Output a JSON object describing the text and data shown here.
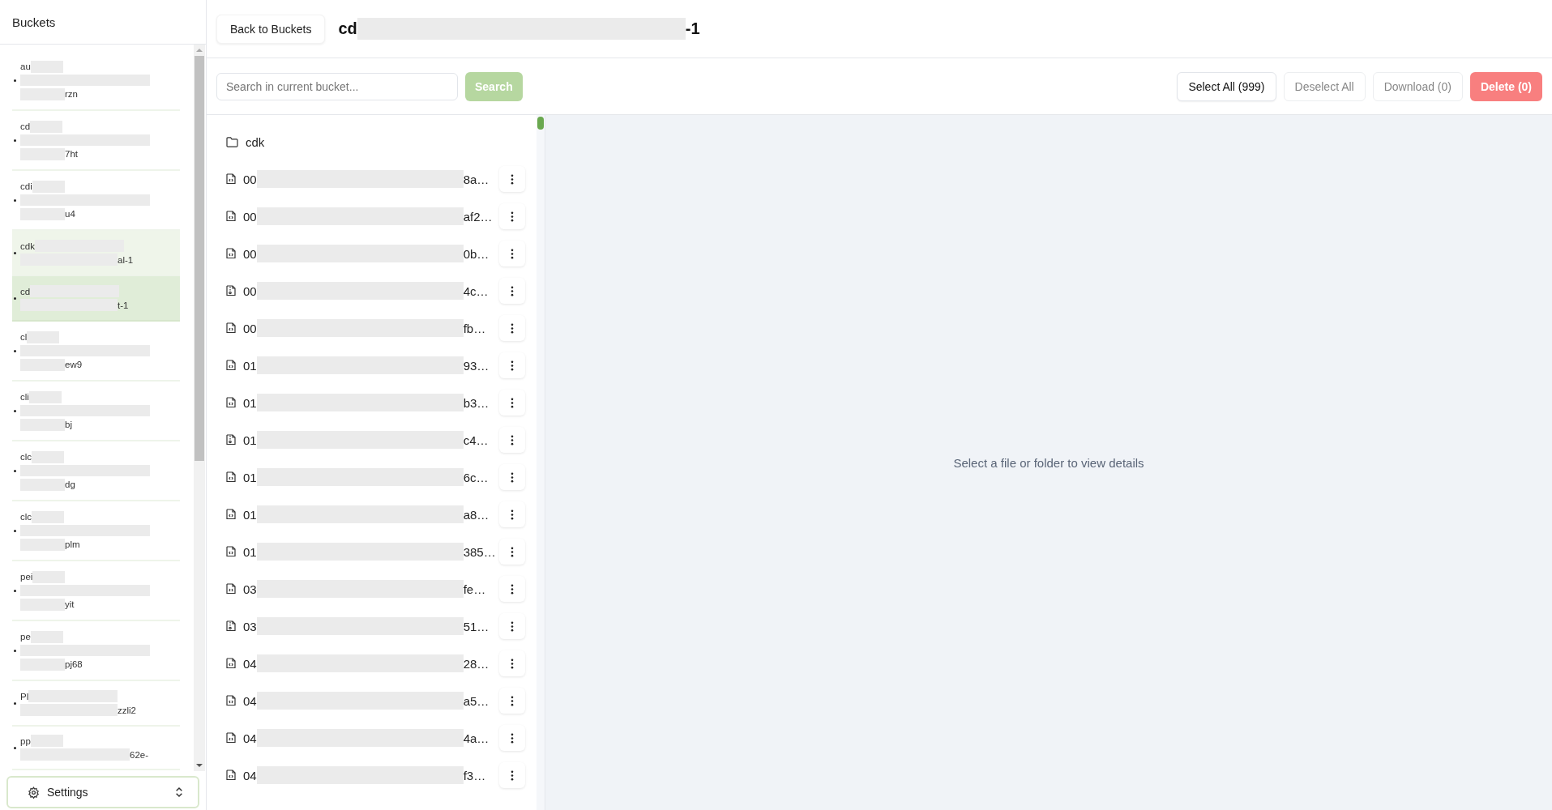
{
  "sidebar": {
    "title": "Buckets",
    "items": [
      {
        "kind": "long",
        "start": "au",
        "end": "rzn",
        "selected": false,
        "hovered": false
      },
      {
        "kind": "long",
        "start": "cd",
        "end": "7ht",
        "selected": false,
        "hovered": false
      },
      {
        "kind": "long",
        "start": "cdi",
        "end": "u4",
        "selected": false,
        "hovered": false
      },
      {
        "kind": "short",
        "start": "cdk",
        "end": "al-1",
        "selected": false,
        "hovered": true
      },
      {
        "kind": "short",
        "start": "cd",
        "end": "t-1",
        "selected": true,
        "hovered": false
      },
      {
        "kind": "long",
        "start": "cl",
        "end": "ew9",
        "selected": false,
        "hovered": false
      },
      {
        "kind": "long",
        "start": "cli",
        "end": "bj",
        "selected": false,
        "hovered": false
      },
      {
        "kind": "long",
        "start": "clc",
        "end": "dg",
        "selected": false,
        "hovered": false
      },
      {
        "kind": "long",
        "start": "clc",
        "end": "plm",
        "selected": false,
        "hovered": false
      },
      {
        "kind": "long",
        "start": "pei",
        "end": "yit",
        "selected": false,
        "hovered": false
      },
      {
        "kind": "long",
        "start": "pe",
        "end": "pj68",
        "selected": false,
        "hovered": false
      },
      {
        "kind": "short",
        "start": "Pl",
        "end": "zzli2",
        "selected": false,
        "hovered": false
      },
      {
        "kind": "open",
        "start": "pp",
        "end": "62e-",
        "selected": false,
        "hovered": false
      }
    ],
    "settings": {
      "label": "Settings"
    }
  },
  "header": {
    "back_button": "Back to Buckets",
    "title_start": "cd",
    "title_end": "-1"
  },
  "toolbar": {
    "search": {
      "placeholder": "Search in current bucket...",
      "button": "Search"
    },
    "actions": [
      {
        "label": "Select All (999)",
        "disabled": false,
        "kind": "plain"
      },
      {
        "label": "Deselect All",
        "disabled": true,
        "kind": "plain"
      },
      {
        "label": "Download (0)",
        "disabled": true,
        "kind": "plain"
      },
      {
        "label": "Delete (0)",
        "disabled": true,
        "kind": "danger"
      }
    ]
  },
  "files": [
    {
      "kind": "folder",
      "start": "cdk"
    },
    {
      "kind": "code",
      "start": "00",
      "end": "8a…"
    },
    {
      "kind": "code",
      "start": "00",
      "end": "af2…"
    },
    {
      "kind": "code",
      "start": "00",
      "end": "0b…"
    },
    {
      "kind": "archive",
      "start": "00",
      "end": "4c…"
    },
    {
      "kind": "code",
      "start": "00",
      "end": "fb…"
    },
    {
      "kind": "code",
      "start": "01",
      "end": "93…"
    },
    {
      "kind": "code",
      "start": "01",
      "end": "b3…"
    },
    {
      "kind": "archive",
      "start": "01",
      "end": "c4…"
    },
    {
      "kind": "code",
      "start": "01",
      "end": "6c…"
    },
    {
      "kind": "code",
      "start": "01",
      "end": "a8…"
    },
    {
      "kind": "code",
      "start": "01",
      "end": "385…"
    },
    {
      "kind": "code",
      "start": "03",
      "end": "fe…"
    },
    {
      "kind": "archive",
      "start": "03",
      "end": "51…"
    },
    {
      "kind": "code",
      "start": "04",
      "end": "28…"
    },
    {
      "kind": "code",
      "start": "04",
      "end": "a5…"
    },
    {
      "kind": "code",
      "start": "04",
      "end": "4a…"
    },
    {
      "kind": "code",
      "start": "04",
      "end": "f3…"
    }
  ],
  "details": {
    "empty_message": "Select a file or folder to view details"
  }
}
